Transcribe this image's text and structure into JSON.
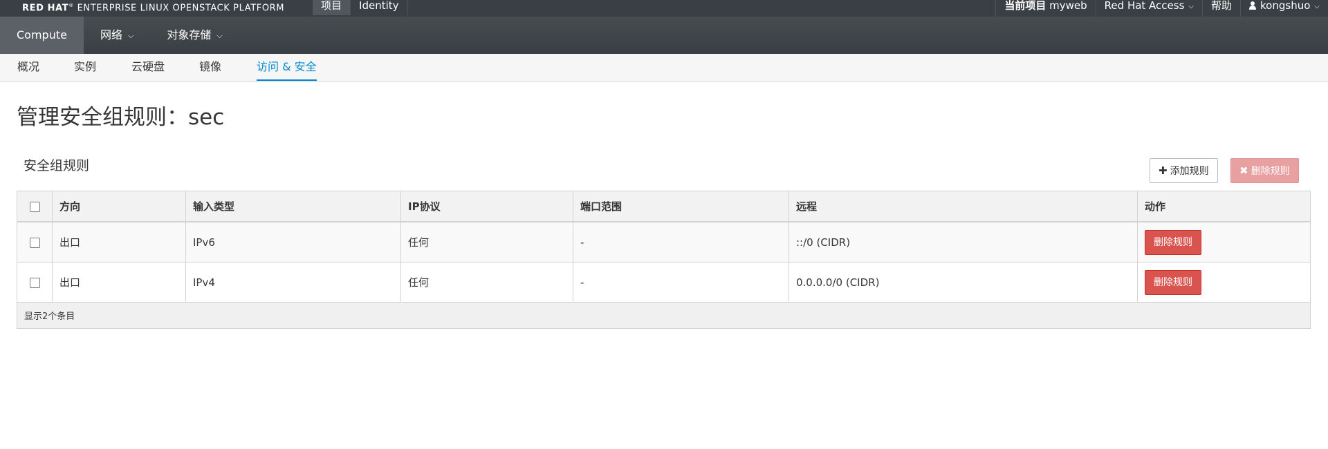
{
  "brand": {
    "prefix": "RED HAT",
    "rest": "ENTERPRISE LINUX OPENSTACK PLATFORM"
  },
  "top_tabs": [
    {
      "label": "项目"
    },
    {
      "label": "Identity"
    }
  ],
  "utility": {
    "project_label": "当前项目",
    "project_value": "myweb",
    "access_label": "Red Hat Access",
    "help_label": "帮助",
    "user_label": "kongshuo"
  },
  "second_nav": [
    {
      "label": "Compute"
    },
    {
      "label": "网络"
    },
    {
      "label": "对象存储"
    }
  ],
  "sub_nav": [
    {
      "label": "概况"
    },
    {
      "label": "实例"
    },
    {
      "label": "云硬盘"
    },
    {
      "label": "镜像"
    },
    {
      "label": "访问 & 安全"
    }
  ],
  "page": {
    "title": "管理安全组规则：sec",
    "section_title": "安全组规则",
    "add_rule_label": "添加规则",
    "delete_rules_label": "删除规则"
  },
  "table": {
    "headers": [
      "方向",
      "输入类型",
      "IP协议",
      "端口范围",
      "远程",
      "动作"
    ],
    "rows": [
      {
        "direction": "出口",
        "ethertype": "IPv6",
        "protocol": "任何",
        "port_range": "-",
        "remote": "::/0 (CIDR)",
        "action": "删除规则"
      },
      {
        "direction": "出口",
        "ethertype": "IPv4",
        "protocol": "任何",
        "port_range": "-",
        "remote": "0.0.0.0/0 (CIDR)",
        "action": "删除规则"
      }
    ],
    "footer": "显示2个条目"
  },
  "colors": {
    "topbar": "#393f44",
    "accent": "#0088ce",
    "danger": "#d9534f"
  }
}
